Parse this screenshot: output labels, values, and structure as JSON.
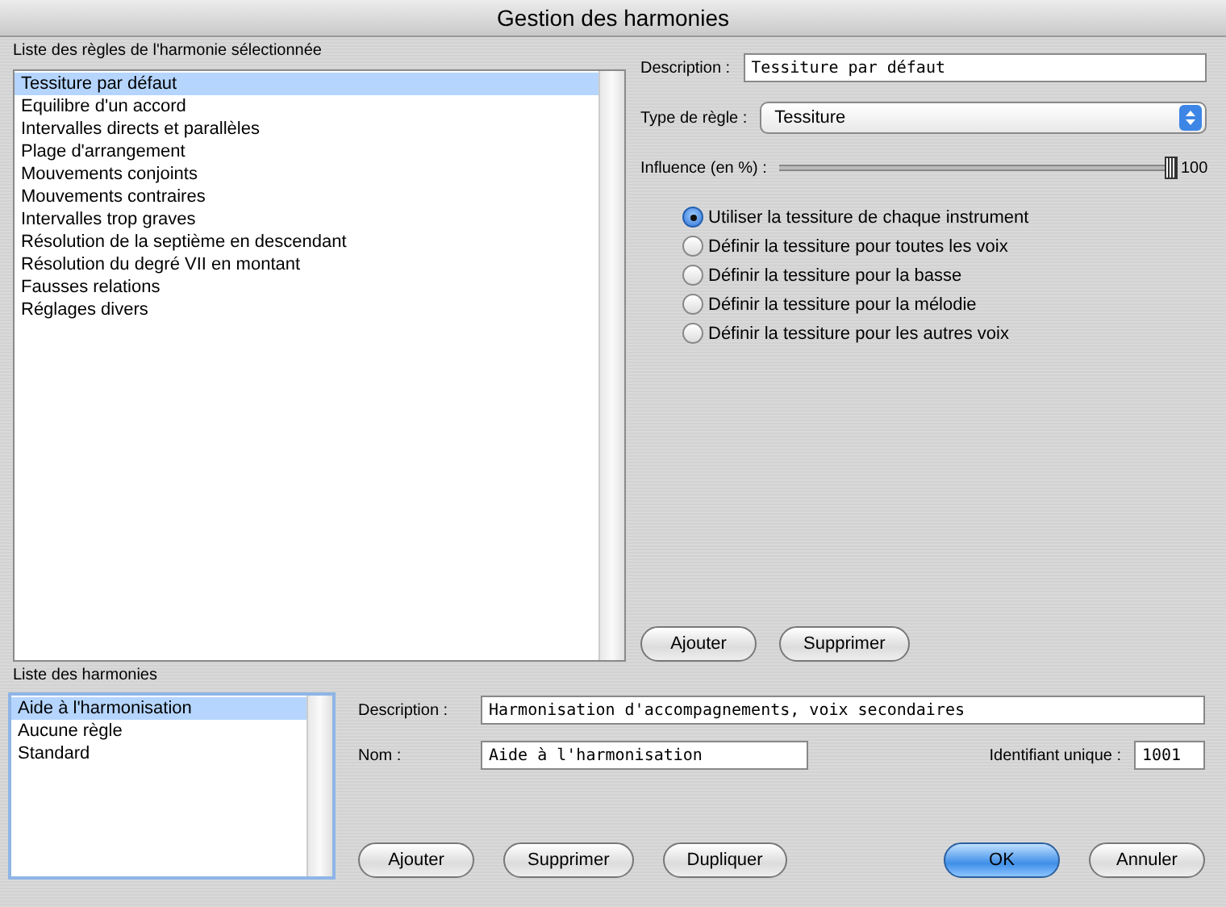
{
  "window": {
    "title": "Gestion des harmonies"
  },
  "rules": {
    "label": "Liste des règles de l'harmonie sélectionnée",
    "items": [
      {
        "label": "Tessiture par défaut",
        "selected": true
      },
      {
        "label": "Equilibre d'un accord",
        "selected": false
      },
      {
        "label": "Intervalles directs et parallèles",
        "selected": false
      },
      {
        "label": "Plage d'arrangement",
        "selected": false
      },
      {
        "label": "Mouvements conjoints",
        "selected": false
      },
      {
        "label": "Mouvements contraires",
        "selected": false
      },
      {
        "label": "Intervalles trop graves",
        "selected": false
      },
      {
        "label": "Résolution de la septième en descendant",
        "selected": false
      },
      {
        "label": "Résolution du degré VII en montant",
        "selected": false
      },
      {
        "label": "Fausses relations",
        "selected": false
      },
      {
        "label": "Réglages divers",
        "selected": false
      }
    ]
  },
  "rule_editor": {
    "description_label": "Description :",
    "description": "Tessiture par défaut",
    "type_label": "Type de règle :",
    "type": "Tessiture",
    "influence": {
      "label": "Influence (en %) :",
      "level": 1,
      "reading": "100"
    },
    "options": [
      {
        "label": "Utiliser la tessiture de chaque instrument",
        "selected": true
      },
      {
        "label": "Définir la tessiture pour toutes les voix",
        "selected": false
      },
      {
        "label": "Définir la tessiture pour la basse",
        "selected": false
      },
      {
        "label": "Définir la tessiture pour la mélodie",
        "selected": false
      },
      {
        "label": "Définir la tessiture pour les autres voix",
        "selected": false
      }
    ],
    "buttons": [
      "Ajouter",
      "Supprimer"
    ]
  },
  "harmonies": {
    "label": "Liste des harmonies",
    "items": [
      {
        "label": "Aide à l'harmonisation",
        "selected": true
      },
      {
        "label": "Aucune règle",
        "selected": false
      },
      {
        "label": "Standard",
        "selected": false
      }
    ]
  },
  "harmony_editor": {
    "description_label": "Description :",
    "description": "Harmonisation d'accompagnements, voix secondaires",
    "name_label": "Nom :",
    "name": "Aide à l'harmonisation",
    "id_label": "Identifiant unique :",
    "id": "1001"
  },
  "harmony_buttons": [
    "Ajouter",
    "Supprimer",
    "Dupliquer"
  ],
  "dialog_buttons": [
    {
      "label": "OK",
      "default": true
    },
    {
      "label": "Annuler",
      "default": false
    }
  ]
}
